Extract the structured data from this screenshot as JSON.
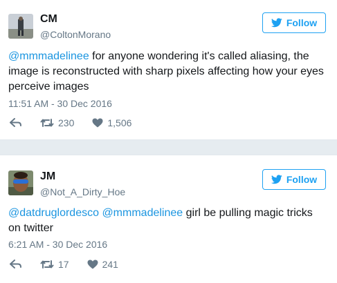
{
  "colors": {
    "accent": "#1da1f2",
    "muted": "#657786",
    "mention": "#1b95e0"
  },
  "tweets": [
    {
      "name": "CM",
      "handle": "@ColtonMorano",
      "follow_label": "Follow",
      "mention": "@mmmadelinee",
      "mention2": "",
      "body": " for anyone wondering it's called aliasing, the image is reconstructed with sharp pixels affecting how your eyes perceive images",
      "timestamp": "11:51 AM - 30 Dec 2016",
      "retweets": "230",
      "likes": "1,506",
      "icons": [
        "reply-icon",
        "retweet-icon",
        "like-icon",
        "twitter-bird-icon"
      ]
    },
    {
      "name": "JM",
      "handle": "@Not_A_Dirty_Hoe",
      "follow_label": "Follow",
      "mention": "@datdruglordesco",
      "mention2": "@mmmadelinee",
      "body": " girl be pulling magic tricks on twitter",
      "timestamp": "6:21 AM - 30 Dec 2016",
      "retweets": "17",
      "likes": "241",
      "icons": [
        "reply-icon",
        "retweet-icon",
        "like-icon",
        "twitter-bird-icon"
      ]
    }
  ]
}
